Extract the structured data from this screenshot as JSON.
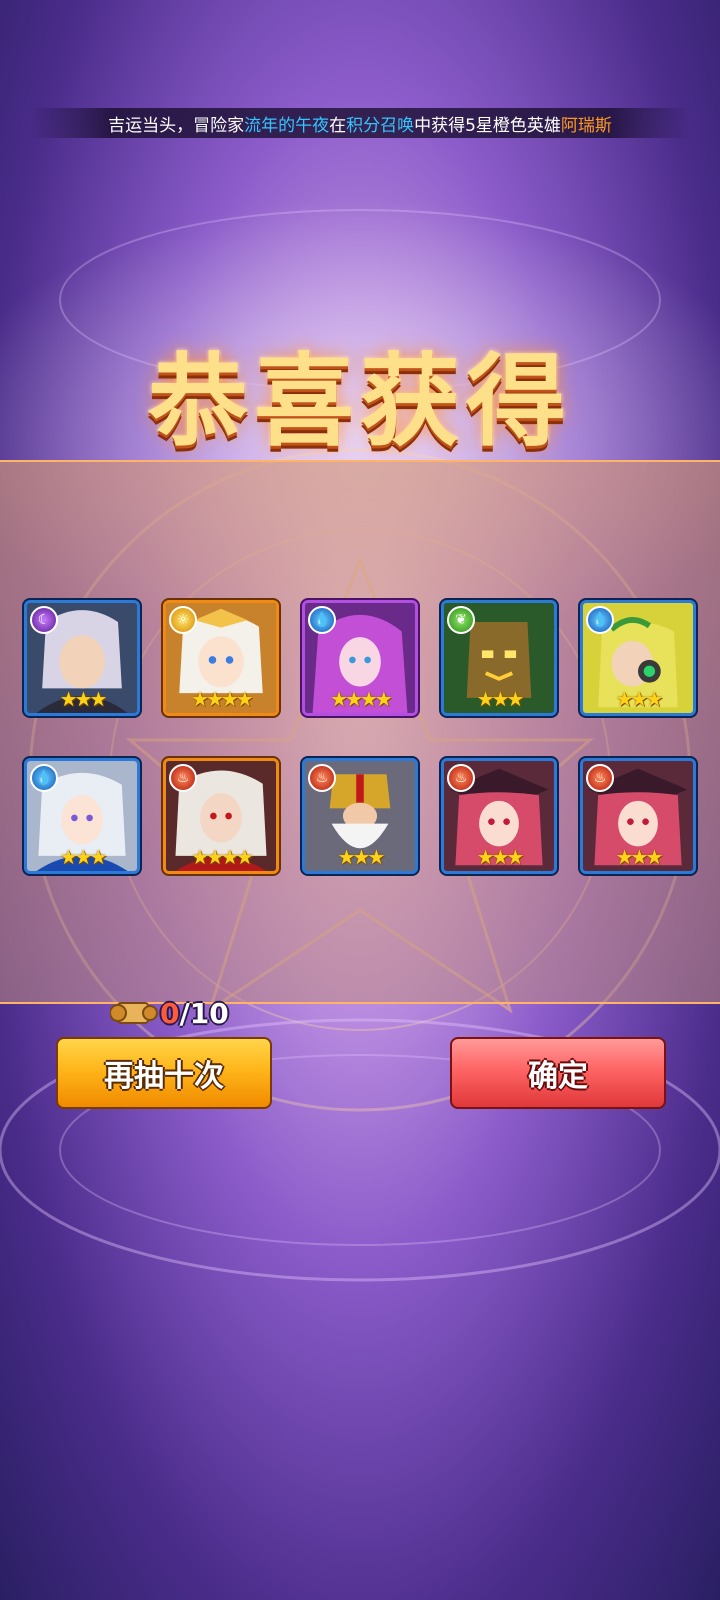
{
  "broadcast": {
    "part1": "吉运当头，冒险家",
    "player": "流年的午夜",
    "part2": "在",
    "event": "积分召唤",
    "part3": "中获得5星橙色英雄",
    "hero": "阿瑞斯"
  },
  "title": "恭喜获得",
  "heroes": [
    {
      "element": "shadow-icon",
      "stars": "★★★",
      "rank": 3
    },
    {
      "element": "light-icon",
      "stars": "★★★★",
      "rank": 4
    },
    {
      "element": "water-icon",
      "stars": "★★★★",
      "rank": 4
    },
    {
      "element": "nature-icon",
      "stars": "★★★",
      "rank": 3
    },
    {
      "element": "water-icon",
      "stars": "★★★",
      "rank": 3
    },
    {
      "element": "water-icon",
      "stars": "★★★",
      "rank": 3
    },
    {
      "element": "fire-icon",
      "stars": "★★★★",
      "rank": 4
    },
    {
      "element": "fire-icon",
      "stars": "★★★",
      "rank": 3
    },
    {
      "element": "fire-icon",
      "stars": "★★★",
      "rank": 3
    },
    {
      "element": "fire-icon",
      "stars": "★★★",
      "rank": 3
    }
  ],
  "counter": {
    "current": "0",
    "total": "/10"
  },
  "buttons": {
    "again": "再抽十次",
    "confirm": "确定"
  },
  "colors": {
    "highlight_blue": "#33c6ff",
    "highlight_orange": "#ff9b1e",
    "gold_button": "#ffb61a",
    "red_button": "#ff6464"
  }
}
